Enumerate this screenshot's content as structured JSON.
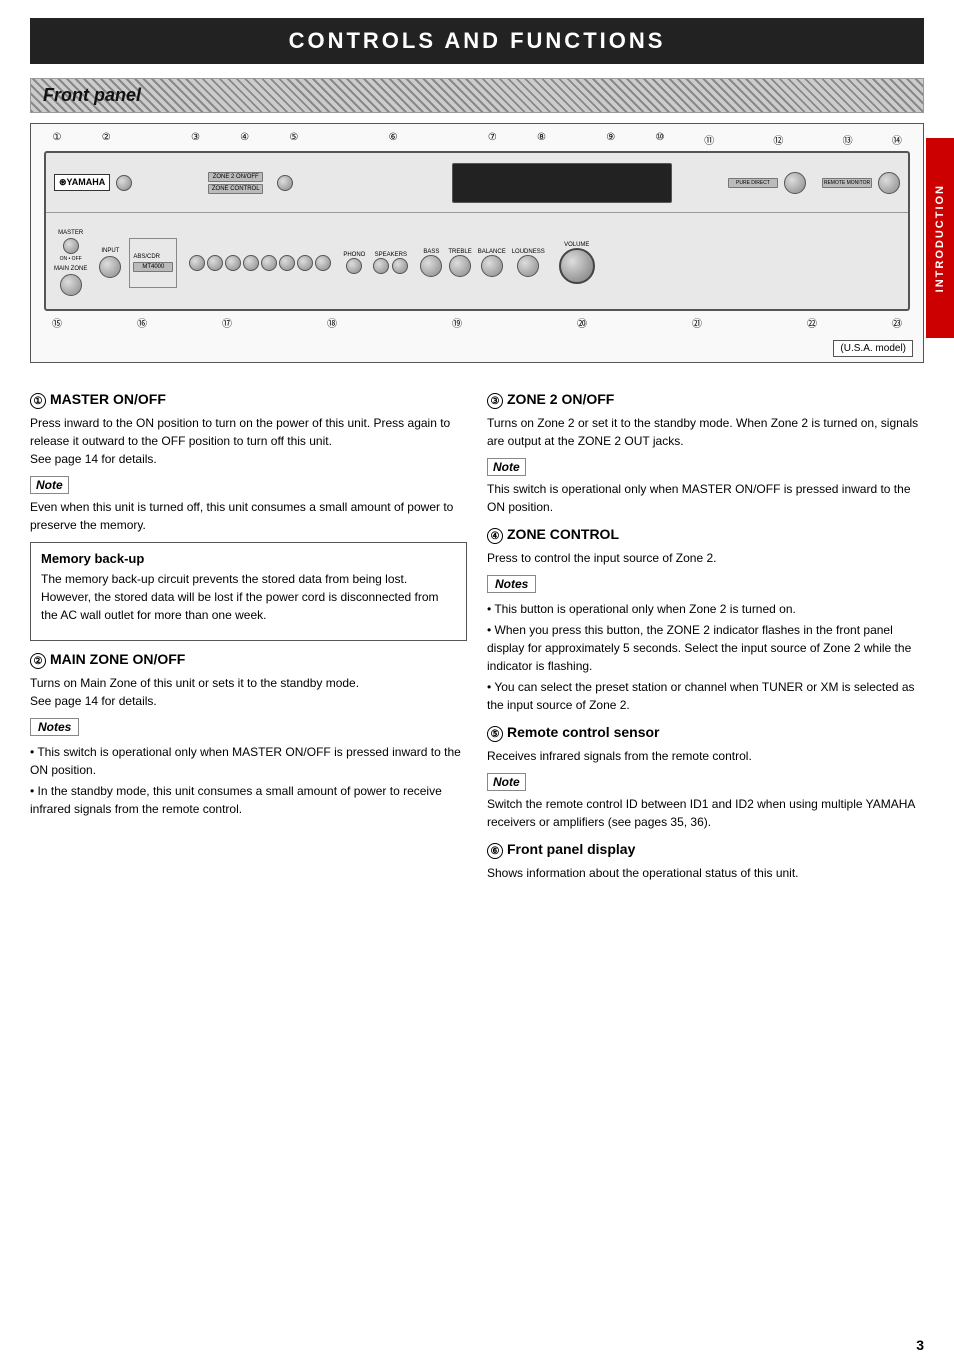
{
  "page": {
    "title": "CONTROLS AND FUNCTIONS",
    "page_number": "3",
    "sidebar_label": "INTRODUCTION"
  },
  "front_panel": {
    "label": "Front panel",
    "usa_model": "(U.S.A. model)",
    "callouts_top": [
      "①",
      "②",
      "③",
      "④",
      "⑤",
      "⑥",
      "⑦",
      "⑧",
      "⑨",
      "⑩",
      "⑪",
      "⑫",
      "⑬",
      "⑭"
    ],
    "callouts_bottom": [
      "⑮",
      "⑯",
      "⑰",
      "⑱",
      "⑲",
      "⑳",
      "㉑",
      "㉒",
      "㉓"
    ]
  },
  "sections": {
    "left": [
      {
        "id": "s1",
        "num": "①",
        "heading": "MASTER ON/OFF",
        "body": "Press inward to the ON position to turn on the power of this unit. Press again to release it outward to the OFF position to turn off this unit.\nSee page 14 for details.",
        "note": {
          "label": "Note",
          "text": "Even when this unit is turned off, this unit consumes a small amount of power to preserve the memory."
        },
        "extra_box": {
          "title": "Memory back-up",
          "text": "The memory back-up circuit prevents the stored data from being lost. However, the stored data will be lost if the power cord is disconnected from the AC wall outlet for more than one week."
        }
      },
      {
        "id": "s2",
        "num": "②",
        "heading": "MAIN ZONE ON/OFF",
        "body": "Turns on Main Zone of this unit or sets it to the standby mode.\nSee page 14 for details.",
        "notes": {
          "label": "Notes",
          "items": [
            "This switch is operational only when MASTER ON/OFF is pressed inward to the ON position.",
            "In the standby mode, this unit consumes a small amount of power to receive infrared signals from the remote control."
          ]
        }
      }
    ],
    "right": [
      {
        "id": "s3",
        "num": "③",
        "heading": "ZONE 2 ON/OFF",
        "body": "Turns on Zone 2 or set it to the standby mode. When Zone 2 is turned on, signals are output at the ZONE 2 OUT jacks.",
        "note": {
          "label": "Note",
          "text": "This switch is operational only when MASTER ON/OFF is pressed inward to the ON position."
        }
      },
      {
        "id": "s4",
        "num": "④",
        "heading": "ZONE CONTROL",
        "body": "Press to control the input source of Zone 2.",
        "notes": {
          "label": "Notes",
          "items": [
            "This button is operational only when Zone 2 is turned on.",
            "When you press this button, the ZONE 2 indicator flashes in the front panel display for approximately 5 seconds. Select the input source of Zone 2 while the indicator is flashing.",
            "You can select the preset station or channel when TUNER or XM is selected as the input source of Zone 2."
          ]
        }
      },
      {
        "id": "s5",
        "num": "⑤",
        "heading": "Remote control sensor",
        "body": "Receives infrared signals from the remote control.",
        "note": {
          "label": "Note",
          "text": "Switch the remote control ID between ID1 and ID2 when using multiple YAMAHA receivers or amplifiers (see pages 35, 36)."
        }
      },
      {
        "id": "s6",
        "num": "⑥",
        "heading": "Front panel display",
        "body": "Shows information about the operational status of this unit."
      }
    ]
  }
}
